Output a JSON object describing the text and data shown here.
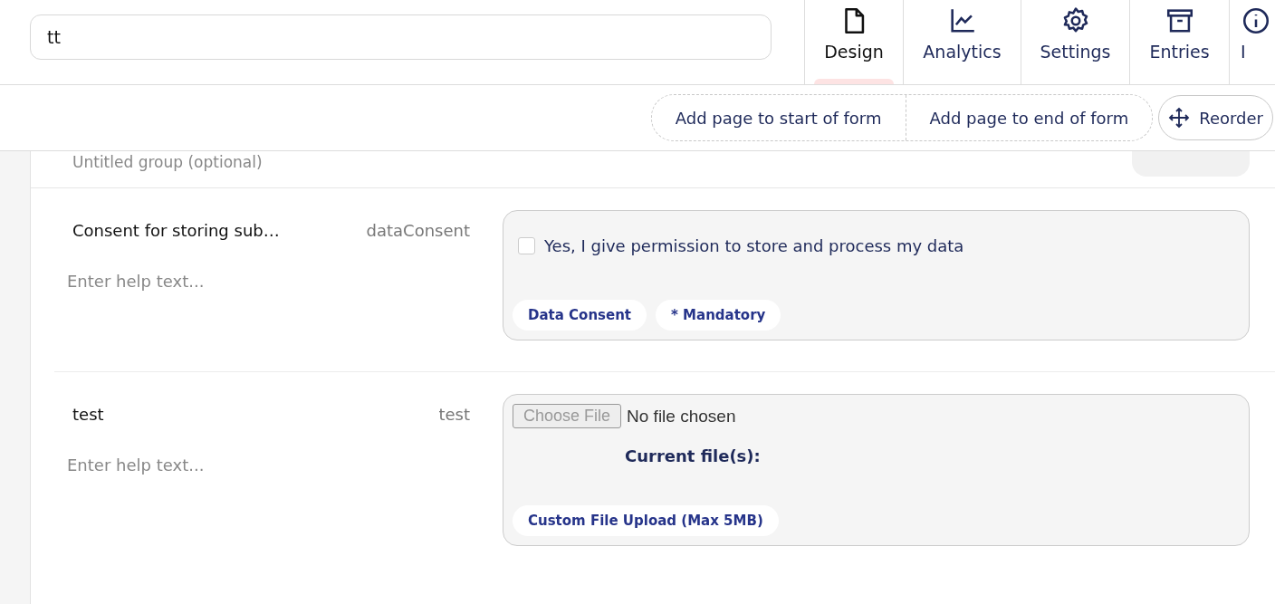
{
  "search": {
    "value": "tt"
  },
  "tabs": [
    {
      "label": "Design",
      "kind": "file",
      "selected": true
    },
    {
      "label": "Analytics",
      "kind": "chart",
      "selected": false
    },
    {
      "label": "Settings",
      "kind": "gear",
      "selected": false
    },
    {
      "label": "Entries",
      "kind": "archive",
      "selected": false
    },
    {
      "label": "I",
      "kind": "info",
      "selected": false
    }
  ],
  "toolbar": {
    "add_start": "Add page to start of form",
    "add_end": "Add page to end of form",
    "reorder": "Reorder"
  },
  "group": {
    "title": "Untitled group (optional)"
  },
  "fields": [
    {
      "kind": "checkbox",
      "label": "Consent for storing sub…",
      "key": "dataConsent",
      "help_placeholder": "Enter help text...",
      "option": "Yes, I give permission to store and process my data",
      "checked": false,
      "tags": [
        "Data Consent",
        "* Mandatory"
      ]
    },
    {
      "kind": "file",
      "label": "test",
      "key": "test",
      "help_placeholder": "Enter help text...",
      "choose": "Choose File",
      "status": "No file chosen",
      "current": "Current file(s):",
      "tags": [
        "Custom File Upload (Max 5MB)"
      ]
    }
  ]
}
